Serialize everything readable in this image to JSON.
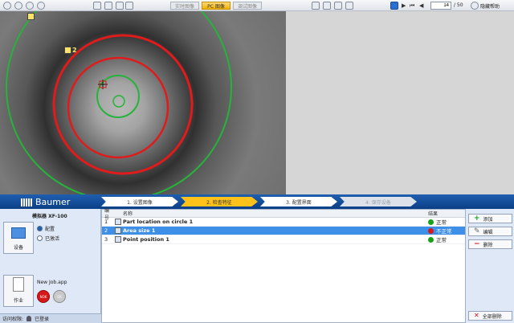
{
  "toolbar": {
    "modes": [
      "实时图像",
      "PC 图像",
      "调试图像"
    ],
    "frame_current": "14",
    "frame_total": "/ 50",
    "help": "隐藏帮助"
  },
  "camera": {
    "roi_label": "2"
  },
  "brand": {
    "name": "Baumer"
  },
  "steps": [
    {
      "label": "1. 设置图像",
      "state": "done"
    },
    {
      "label": "2. 检查特征",
      "state": "active"
    },
    {
      "label": "3. 配置界面",
      "state": "done"
    },
    {
      "label": "4. 保存设备",
      "state": "disabled"
    }
  ],
  "left_panel": {
    "sensor_name": "模拟器 XF-100",
    "device_button": "设备",
    "radio_options": [
      {
        "label": "配置",
        "selected": true
      },
      {
        "label": "已激活",
        "selected": false
      }
    ],
    "job_file": "New Job.app",
    "job_button": "作业",
    "circle_red": "NOK",
    "circle_gray": "OK",
    "status_label": "访问权限:",
    "status_user": "已登录"
  },
  "table": {
    "header_num": "编号",
    "header_name": "名称",
    "header_result": "结果",
    "rows": [
      {
        "num": "1",
        "name": "Part location on circle 1",
        "result": "正常",
        "status_color": "#17a317",
        "selected": false
      },
      {
        "num": "2",
        "name": "Area size 1",
        "result": "不正常",
        "status_color": "#d81818",
        "selected": true
      },
      {
        "num": "3",
        "name": "Point position 1",
        "result": "正常",
        "status_color": "#17a317",
        "selected": false
      }
    ]
  },
  "actions": {
    "add": "添加",
    "edit": "编辑",
    "delete": "删除",
    "delete_all": "全部删除"
  },
  "colors": {
    "accent_blue": "#1f5fb0",
    "step_active": "#ffc21a",
    "roi_red": "#e01b1b",
    "roi_green": "#26b33a"
  }
}
